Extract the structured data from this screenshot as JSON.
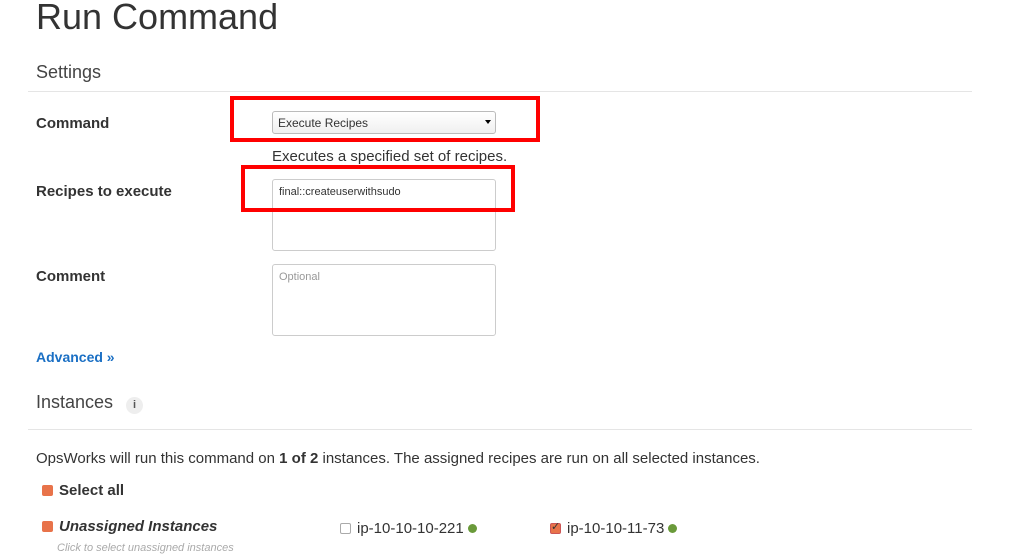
{
  "title": "Run Command",
  "settings": {
    "heading": "Settings",
    "command_label": "Command",
    "command_value": "Execute Recipes",
    "command_help": "Executes a specified set of recipes.",
    "recipes_label": "Recipes to execute",
    "recipes_value": "final::createuserwithsudo",
    "comment_label": "Comment",
    "comment_placeholder": "Optional",
    "advanced_link": "Advanced »"
  },
  "instances": {
    "heading": "Instances",
    "info_icon": "i",
    "summary_prefix": "OpsWorks will run this command on ",
    "summary_count": "1 of 2",
    "summary_suffix": " instances. The assigned recipes are run on all selected instances.",
    "select_all": "Select all",
    "group_label": "Unassigned Instances",
    "group_hint": "Click to select unassigned instances",
    "items": [
      {
        "name": "ip-10-10-10-221",
        "checked": false,
        "status_color": "#6a9a3a"
      },
      {
        "name": "ip-10-10-11-73",
        "checked": true,
        "status_color": "#6a9a3a"
      }
    ]
  },
  "colors": {
    "highlight": "#ff0000",
    "link": "#1a6fc4",
    "checkbox": "#e8734a"
  }
}
